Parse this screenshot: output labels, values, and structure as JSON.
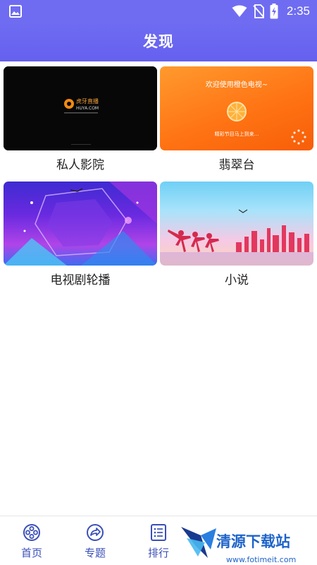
{
  "status_bar": {
    "time": "2:35",
    "icons": [
      "image-icon",
      "wifi-icon",
      "no-sim-icon",
      "battery-charging-icon"
    ]
  },
  "header": {
    "title": "发现"
  },
  "cards": [
    {
      "label": "私人影院",
      "thumb_text": "虎牙直播",
      "thumb_subtext": "HUYA.COM"
    },
    {
      "label": "翡翠台",
      "thumb_text": "欢迎使用橙色电视~",
      "thumb_subtext": "精彩节目马上到来..."
    },
    {
      "label": "电视剧轮播"
    },
    {
      "label": "小说"
    }
  ],
  "bottom_nav": [
    {
      "label": "首页",
      "icon": "film-reel-icon"
    },
    {
      "label": "专题",
      "icon": "share-arrow-icon"
    },
    {
      "label": "排行",
      "icon": "list-icon"
    }
  ],
  "watermark": {
    "text": "清源下载站",
    "subtext": "www.fotimeit.com"
  },
  "colors": {
    "accent": "#6f6cf2",
    "nav_text": "#3a4fb8"
  }
}
